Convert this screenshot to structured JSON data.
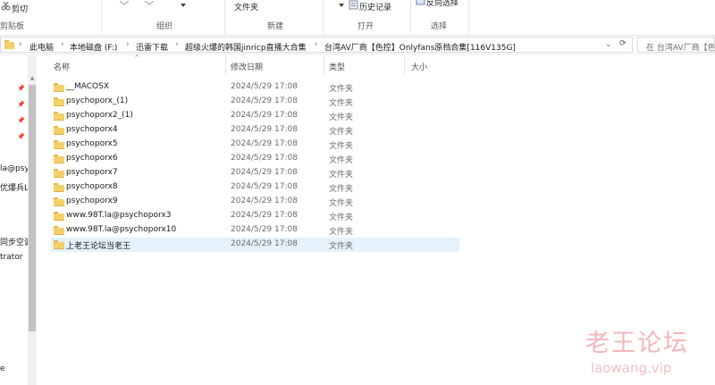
{
  "ribbon": {
    "cut_label": "剪切",
    "clipboard_group": "剪贴板",
    "organize_group": "组织",
    "folder_label": "文件夹",
    "new_group": "新建",
    "history_label": "历史记录",
    "open_group": "打开",
    "invert_label": "反向选择",
    "select_group": "选择"
  },
  "address": {
    "crumbs": [
      "此电脑",
      "本地磁盘 (F:)",
      "迅雷下载",
      "超级火爆的韩国jinricp直播大合集",
      "台湾AV厂商【色控】Onlyfans原档合集[116V135G]"
    ],
    "search_placeholder": "在 台湾AV厂商【色"
  },
  "nav": {
    "items": [
      "la@psy",
      "优爆兵L",
      "同步空调",
      "trator",
      "e"
    ]
  },
  "columns": {
    "name": "名称",
    "date": "修改日期",
    "type": "类型",
    "size": "大小"
  },
  "files": [
    {
      "name": "__MACOSX",
      "date": "2024/5/29 17:08",
      "type": "文件夹"
    },
    {
      "name": "psychoporx_(1)",
      "date": "2024/5/29 17:08",
      "type": "文件夹"
    },
    {
      "name": "psychoporx2_(1)",
      "date": "2024/5/29 17:08",
      "type": "文件夹"
    },
    {
      "name": "psychoporx4",
      "date": "2024/5/29 17:08",
      "type": "文件夹"
    },
    {
      "name": "psychoporx5",
      "date": "2024/5/29 17:08",
      "type": "文件夹"
    },
    {
      "name": "psychoporx6",
      "date": "2024/5/29 17:08",
      "type": "文件夹"
    },
    {
      "name": "psychoporx7",
      "date": "2024/5/29 17:08",
      "type": "文件夹"
    },
    {
      "name": "psychoporx8",
      "date": "2024/5/29 17:08",
      "type": "文件夹"
    },
    {
      "name": "psychoporx9",
      "date": "2024/5/29 17:08",
      "type": "文件夹"
    },
    {
      "name": "www.98T.la@psychoporx3",
      "date": "2024/5/29 17:08",
      "type": "文件夹"
    },
    {
      "name": "www.98T.la@psychoporx10",
      "date": "2024/5/29 17:08",
      "type": "文件夹"
    },
    {
      "name": "上老王论坛当老王",
      "date": "2024/5/29 17:08",
      "type": "文件夹"
    }
  ],
  "watermark": {
    "cn": "老王论坛",
    "en": "laowang.vip"
  }
}
